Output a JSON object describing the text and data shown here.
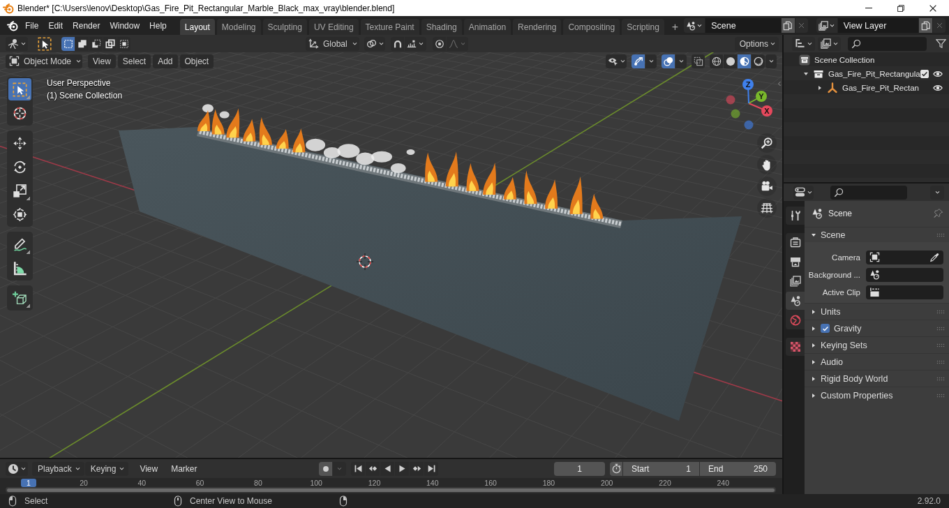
{
  "window": {
    "title": "Blender* [C:\\Users\\lenov\\Desktop\\Gas_Fire_Pit_Rectangular_Marble_Black_max_vray\\blender.blend]"
  },
  "menu": [
    "File",
    "Edit",
    "Render",
    "Window",
    "Help"
  ],
  "workspace_tabs": [
    {
      "label": "Layout",
      "selected": true
    },
    {
      "label": "Modeling",
      "selected": false
    },
    {
      "label": "Sculpting",
      "selected": false
    },
    {
      "label": "UV Editing",
      "selected": false
    },
    {
      "label": "Texture Paint",
      "selected": false
    },
    {
      "label": "Shading",
      "selected": false
    },
    {
      "label": "Animation",
      "selected": false
    },
    {
      "label": "Rendering",
      "selected": false
    },
    {
      "label": "Compositing",
      "selected": false
    },
    {
      "label": "Scripting",
      "selected": false
    }
  ],
  "add_tab": "+",
  "scene": {
    "value": "Scene"
  },
  "view_layer": {
    "value": "View Layer"
  },
  "viewport": {
    "select_modes": [
      {
        "selected": true
      },
      {
        "selected": false
      },
      {
        "selected": false
      },
      {
        "selected": false
      },
      {
        "selected": false
      }
    ],
    "orientation": "Global",
    "snapping": {
      "on": false
    },
    "proportional_editing": {
      "on": false
    },
    "options": "Options",
    "mode": "Object Mode",
    "menus": [
      "View",
      "Select",
      "Add",
      "Object"
    ],
    "overlay_toggles": [
      {
        "on": true
      },
      {
        "on": true
      },
      {
        "on": false
      }
    ],
    "shading_modes": [
      {
        "selected": false
      },
      {
        "selected": false
      },
      {
        "selected": true
      },
      {
        "selected": false
      }
    ],
    "tool_groups": [
      [
        {
          "selected": true
        },
        {
          "selected": false
        }
      ],
      [
        {
          "selected": false
        },
        {
          "selected": false
        },
        {
          "selected": false
        },
        {
          "selected": false
        }
      ],
      [
        {
          "selected": false
        },
        {
          "selected": false
        }
      ],
      [
        {
          "selected": false
        }
      ]
    ],
    "view_name": "User Perspective",
    "collection_info": "(1) Scene Collection",
    "gizmo_axes": [
      {
        "label": "X",
        "color": "#e5485c"
      },
      {
        "label": "Y",
        "color": "#79b82b"
      },
      {
        "label": "Z",
        "color": "#3f80ec"
      }
    ]
  },
  "outliner": {
    "tree": [
      {
        "label": "Scene Collection",
        "kind": "scene_collection",
        "children": [
          {
            "label": "Gas_Fire_Pit_Rectangula",
            "kind": "collection",
            "expanded": true,
            "checked": true,
            "visible": true,
            "children": [
              {
                "label": "Gas_Fire_Pit_Rectan",
                "kind": "empty",
                "expanded": false,
                "visible": true
              }
            ]
          }
        ]
      }
    ]
  },
  "properties": {
    "tab_groups": [
      [
        {
          "selected": false
        }
      ],
      [
        {
          "selected": false
        },
        {
          "selected": false
        },
        {
          "selected": false
        },
        {
          "selected": true
        },
        {
          "selected": false
        }
      ],
      [
        {
          "selected": false
        }
      ]
    ],
    "context": "Scene",
    "panels": [
      {
        "label": "Scene",
        "kind": "plain",
        "expanded": true,
        "fields": [
          {
            "label": "Camera"
          },
          {
            "label": "Background ..."
          },
          {
            "label": "Active Clip"
          }
        ]
      },
      {
        "label": "Units",
        "kind": "plain",
        "expanded": false
      },
      {
        "label": "Gravity",
        "kind": "checkbox",
        "expanded": false,
        "checked": true
      },
      {
        "label": "Keying Sets",
        "kind": "plain",
        "expanded": false
      },
      {
        "label": "Audio",
        "kind": "plain",
        "expanded": false
      },
      {
        "label": "Rigid Body World",
        "kind": "plain",
        "expanded": false
      },
      {
        "label": "Custom Properties",
        "kind": "plain",
        "expanded": false
      }
    ]
  },
  "timeline": {
    "menus": [
      {
        "label": "Playback",
        "kind": "dropdown"
      },
      {
        "label": "Keying",
        "kind": "dropdown"
      },
      {
        "label": "View",
        "kind": "menu"
      },
      {
        "label": "Marker",
        "kind": "menu"
      }
    ],
    "auto_keying": {
      "on": false
    },
    "current_frame": "1",
    "start": {
      "label": "Start",
      "value": "1"
    },
    "end": {
      "label": "End",
      "value": "250"
    },
    "playhead": "1",
    "ruler": [
      "20",
      "40",
      "60",
      "80",
      "100",
      "120",
      "140",
      "160",
      "180",
      "200",
      "220",
      "240"
    ]
  },
  "status_bar": {
    "hints": [
      "Select",
      "Center View to Mouse"
    ],
    "version": "2.92.0"
  }
}
